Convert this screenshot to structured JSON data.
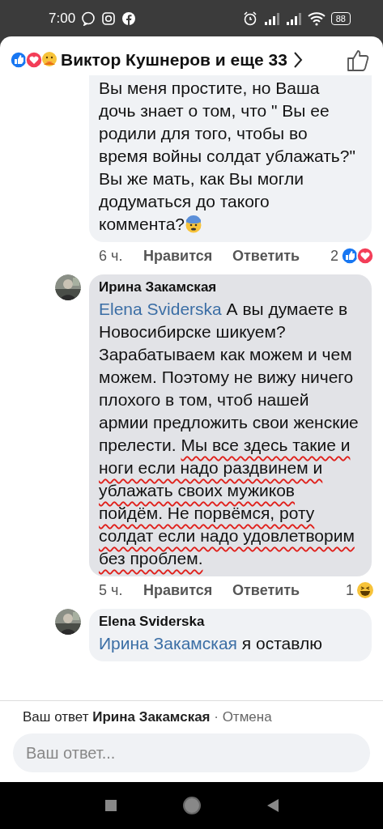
{
  "status_bar": {
    "time": "7:00",
    "battery": "88"
  },
  "header": {
    "reactions": [
      {
        "kind": "like"
      },
      {
        "kind": "love"
      },
      {
        "kind": "care"
      }
    ],
    "reactors": "Виктор Кушнеров и еще 33"
  },
  "comments": [
    {
      "highlighted": false,
      "body": [
        {
          "kind": "text",
          "text": "Вы меня простите, но Ваша дочь знает о том, что \" Вы ее родили для того, чтобы во время войны солдат ублажать?\"\nВы же мать, как Вы могли додуматься до такого коммента?"
        },
        {
          "kind": "emoji"
        }
      ],
      "meta": {
        "time": "6 ч.",
        "like": "Нравится",
        "reply": "Ответить",
        "count": "2",
        "reactions": [
          {
            "kind": "like"
          },
          {
            "kind": "love"
          }
        ]
      }
    },
    {
      "highlighted": true,
      "avatar": {
        "kind": "picture"
      },
      "author": "Ирина Закамская",
      "body": [
        {
          "kind": "mention",
          "text": "Elena Sviderska"
        },
        {
          "kind": "text",
          "text": " А вы думаете в Новосибирске шикуем? Зарабатываем как можем и чем можем. Поэтому не вижу ничего плохого в том, чтоб нашей армии предложить свои женские прелести. "
        },
        {
          "kind": "underlined",
          "text": "Мы все здесь такие и ноги если надо раздвинем и ублажать своих мужиков пойдём. Не порвёмся, роту солдат если надо удовлетворим без проблем."
        }
      ],
      "meta": {
        "time": "5 ч.",
        "like": "Нравится",
        "reply": "Ответить",
        "count": "1",
        "reactions": [
          {
            "kind": "haha"
          }
        ]
      }
    },
    {
      "highlighted": false,
      "avatar": {
        "kind": "picture"
      },
      "author": "Elena Sviderska",
      "body": [
        {
          "kind": "mention",
          "text": "Ирина Закамская"
        },
        {
          "kind": "text",
          "text": " я оставлю"
        }
      ]
    }
  ],
  "reply_bar": {
    "prefix": "Ваш ответ",
    "name": "Ирина Закамская",
    "separator": "·",
    "cancel": "Отмена"
  },
  "input": {
    "placeholder": "Ваш ответ..."
  }
}
